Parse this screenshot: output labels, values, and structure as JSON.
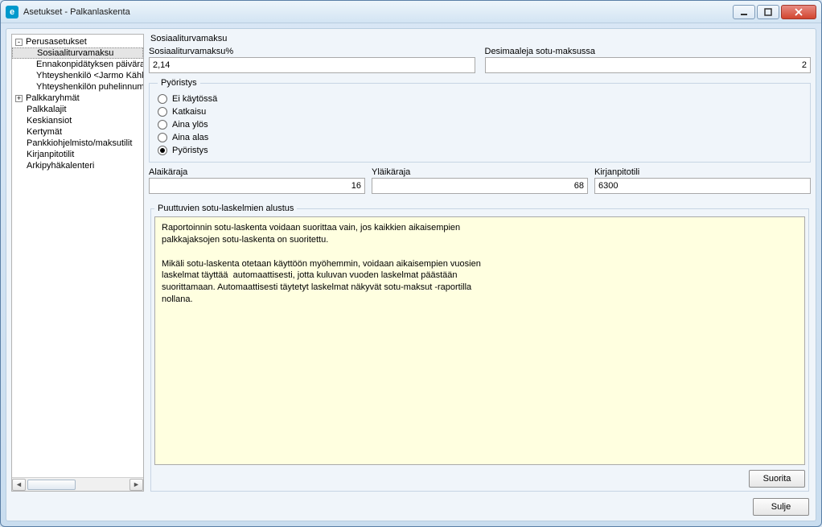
{
  "window": {
    "title": "Asetukset - Palkanlaskenta",
    "app_icon_letter": "e"
  },
  "sidebar": {
    "root": {
      "label": "Perusasetukset",
      "children": [
        {
          "label": "Sosiaaliturvamaksu",
          "selected": true
        },
        {
          "label": "Ennakonpidätyksen päiväraha"
        },
        {
          "label": "Yhteyshenkilö <Jarmo Kähkönen>"
        },
        {
          "label": "Yhteyshenkilön puhelinnumero"
        }
      ]
    },
    "groups": [
      {
        "label": "Palkkaryhmät",
        "expandable": true
      },
      {
        "label": "Palkkalajit"
      },
      {
        "label": "Keskiansiot"
      },
      {
        "label": "Kertymät"
      },
      {
        "label": "Pankkiohjelmisto/maksutilit"
      },
      {
        "label": "Kirjanpitotilit"
      },
      {
        "label": "Arkipyhäkalenteri"
      }
    ]
  },
  "main": {
    "heading": "Sosiaaliturvamaksu",
    "sotu_percent": {
      "label": "Sosiaaliturvamaksu%",
      "value": "2,14"
    },
    "decimals": {
      "label": "Desimaaleja sotu-maksussa",
      "value": "2"
    },
    "rounding": {
      "legend": "Pyöristys",
      "options": [
        {
          "label": "Ei käytössä",
          "checked": false
        },
        {
          "label": "Katkaisu",
          "checked": false
        },
        {
          "label": "Aina ylös",
          "checked": false
        },
        {
          "label": "Aina alas",
          "checked": false
        },
        {
          "label": "Pyöristys",
          "checked": true
        }
      ]
    },
    "min_age": {
      "label": "Alaikäraja",
      "value": "16"
    },
    "max_age": {
      "label": "Yläikäraja",
      "value": "68"
    },
    "account": {
      "label": "Kirjanpitotili",
      "value": "6300"
    },
    "missing": {
      "legend": "Puuttuvien sotu-laskelmien alustus",
      "text": "Raportoinnin sotu-laskenta voidaan suorittaa vain, jos kaikkien aikaisempien\npalkkajaksojen sotu-laskenta on suoritettu.\n\nMikäli sotu-laskenta otetaan käyttöön myöhemmin, voidaan aikaisempien vuosien\nlaskelmat täyttää  automaattisesti, jotta kuluvan vuoden laskelmat päästään\nsuorittamaan. Automaattisesti täytetyt laskelmat näkyvät sotu-maksut -raportilla\nnollana.",
      "button": "Suorita"
    }
  },
  "footer": {
    "close": "Sulje"
  }
}
